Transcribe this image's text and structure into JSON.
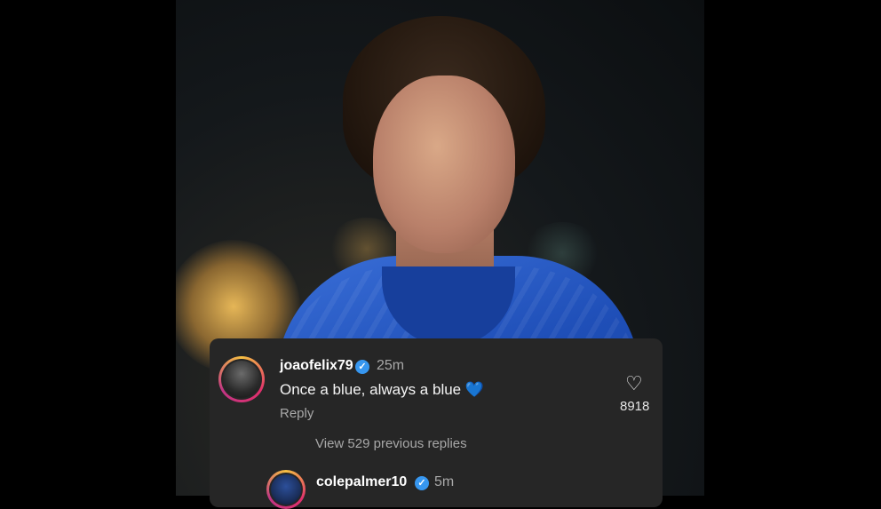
{
  "comment1": {
    "username": "joaofelix79",
    "time": "25m",
    "text": "Once a blue, always a blue",
    "emoji": "💙",
    "reply_label": "Reply",
    "likes": "8918"
  },
  "view_replies": "View 529 previous replies",
  "comment2": {
    "username": "colepalmer10",
    "time": "5m"
  },
  "icons": {
    "verified": "verified-badge-icon",
    "heart": "heart-outline-icon"
  },
  "colors": {
    "card_bg": "#262626",
    "verified_blue": "#3797f0",
    "secondary_text": "#a8a8a8"
  }
}
